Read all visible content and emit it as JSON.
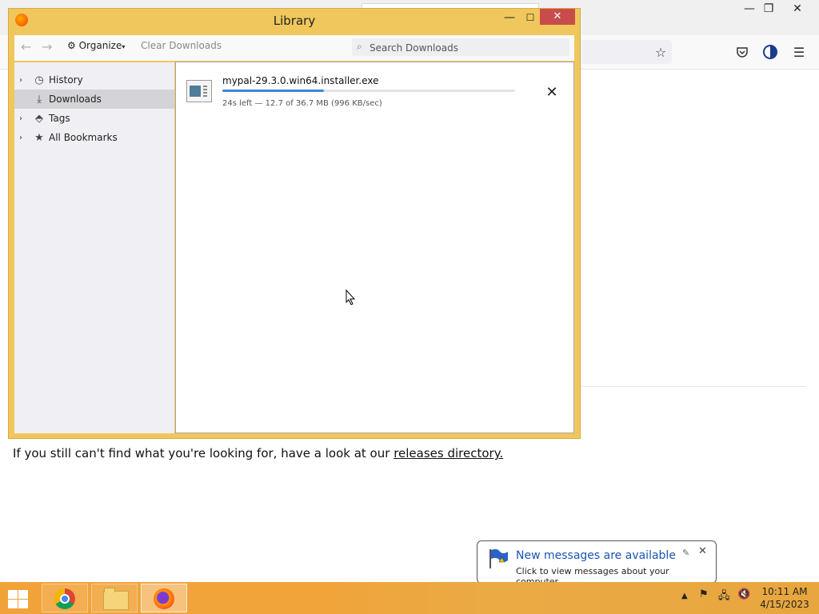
{
  "browser": {
    "window_controls": {
      "minimize": "—",
      "restore": "❐",
      "close": "✕"
    },
    "icons": [
      "star-icon",
      "pocket-icon",
      "account-icon",
      "menu-icon"
    ],
    "page_text": "If you still can't find what you're looking for, have a look at our",
    "page_link": "releases directory."
  },
  "library": {
    "title": "Library",
    "toolbar": {
      "organize_label": "Organize",
      "clear_downloads_label": "Clear Downloads",
      "search_placeholder": "Search Downloads",
      "search_value": ""
    },
    "sidebar": [
      {
        "label": "History",
        "icon": "clock-icon",
        "expandable": true,
        "selected": false
      },
      {
        "label": "Downloads",
        "icon": "download-icon",
        "expandable": false,
        "selected": true
      },
      {
        "label": "Tags",
        "icon": "tag-icon",
        "expandable": true,
        "selected": false
      },
      {
        "label": "All Bookmarks",
        "icon": "star-icon",
        "expandable": true,
        "selected": false
      }
    ],
    "downloads": [
      {
        "filename": "mypal-29.3.0.win64.installer.exe",
        "status": "24s left — 12.7 of 36.7 MB (996 KB/sec)",
        "progress_percent": 34.6
      }
    ]
  },
  "notification": {
    "title": "New messages are available",
    "text": "Click to view messages about your computer."
  },
  "taskbar": {
    "apps": [
      "chrome-icon",
      "file-explorer-icon",
      "firefox-icon"
    ],
    "active_app": "firefox-icon",
    "time": "10:11 AM",
    "date": "4/15/2023"
  },
  "colors": {
    "window_frame": "#f0c75c",
    "taskbar": "#f1a33a",
    "progress": "#3d86d9",
    "notification_title": "#1a55b3"
  }
}
